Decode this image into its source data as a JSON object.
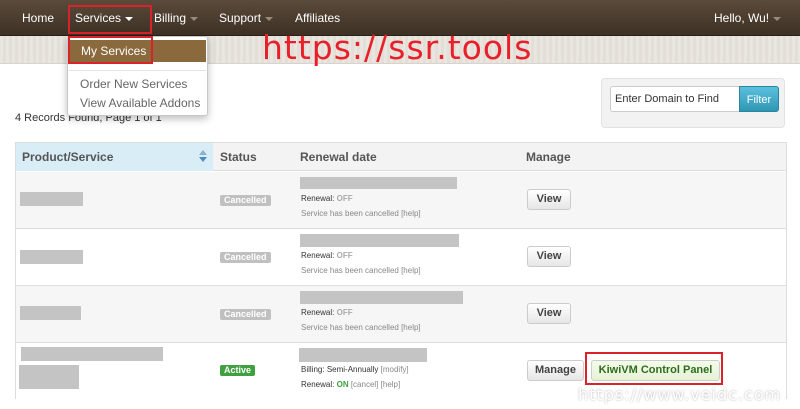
{
  "nav": {
    "home": "Home",
    "services": "Services",
    "billing": "Billing",
    "support": "Support",
    "affiliates": "Affiliates",
    "user": "Hello, Wu!"
  },
  "dropdown": {
    "my_services": "My Services",
    "order_new": "Order New Services",
    "view_addons": "View Available Addons"
  },
  "watermark": {
    "top": "https://ssr.tools",
    "bottom": "https://www.veidc.com"
  },
  "records_text": "4 Records Found, Page 1 of 1",
  "filter": {
    "placeholder": "Enter Domain to Find",
    "button": "Filter"
  },
  "table": {
    "headers": {
      "product": "Product/Service",
      "status": "Status",
      "renewal": "Renewal date",
      "manage": "Manage"
    },
    "rows": [
      {
        "status": "Cancelled",
        "renewal_label": "Renewal:",
        "renewal_value": "OFF",
        "note": "Service has been cancelled",
        "help": "[help]",
        "button": "View"
      },
      {
        "status": "Cancelled",
        "renewal_label": "Renewal:",
        "renewal_value": "OFF",
        "note": "Service has been cancelled",
        "help": "[help]",
        "button": "View"
      },
      {
        "status": "Cancelled",
        "renewal_label": "Renewal:",
        "renewal_value": "OFF",
        "note": "Service has been cancelled",
        "help": "[help]",
        "button": "View"
      },
      {
        "status": "Active",
        "billing_label": "Billing:",
        "billing_value": "Semi-Annually",
        "modify": "[modify]",
        "renewal_label": "Renewal:",
        "renewal_value": "ON",
        "cancel": "[cancel]",
        "help": "[help]",
        "button": "Manage",
        "button2": "KiwiVM Control Panel"
      }
    ]
  },
  "colors": {
    "nav_bg": "#4a3c2e",
    "accent_red": "#d9222a",
    "active_green": "#3ea03e",
    "filter_blue": "#2f96b4"
  }
}
